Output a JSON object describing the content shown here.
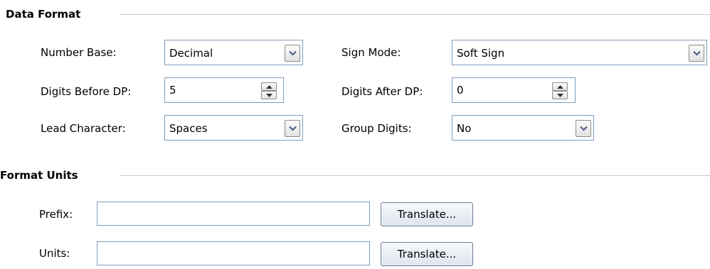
{
  "data_format": {
    "title": "Data Format",
    "number_base": {
      "label": "Number Base:",
      "value": "Decimal"
    },
    "sign_mode": {
      "label": "Sign Mode:",
      "value": "Soft Sign"
    },
    "digits_before_dp": {
      "label": "Digits Before DP:",
      "value": "5"
    },
    "digits_after_dp": {
      "label": "Digits After DP:",
      "value": "0"
    },
    "lead_character": {
      "label": "Lead Character:",
      "value": "Spaces"
    },
    "group_digits": {
      "label": "Group Digits:",
      "value": "No"
    }
  },
  "format_units": {
    "title": "Format Units",
    "prefix": {
      "label": "Prefix:",
      "value": "",
      "button": "Translate..."
    },
    "units": {
      "label": "Units:",
      "value": "",
      "button": "Translate..."
    }
  },
  "icons": {
    "dropdown": "chevron-down-icon",
    "spin_up": "spin-up-icon",
    "spin_down": "spin-down-icon"
  },
  "colors": {
    "field_border": "#7f9db9",
    "separator": "#c8c8c8"
  }
}
